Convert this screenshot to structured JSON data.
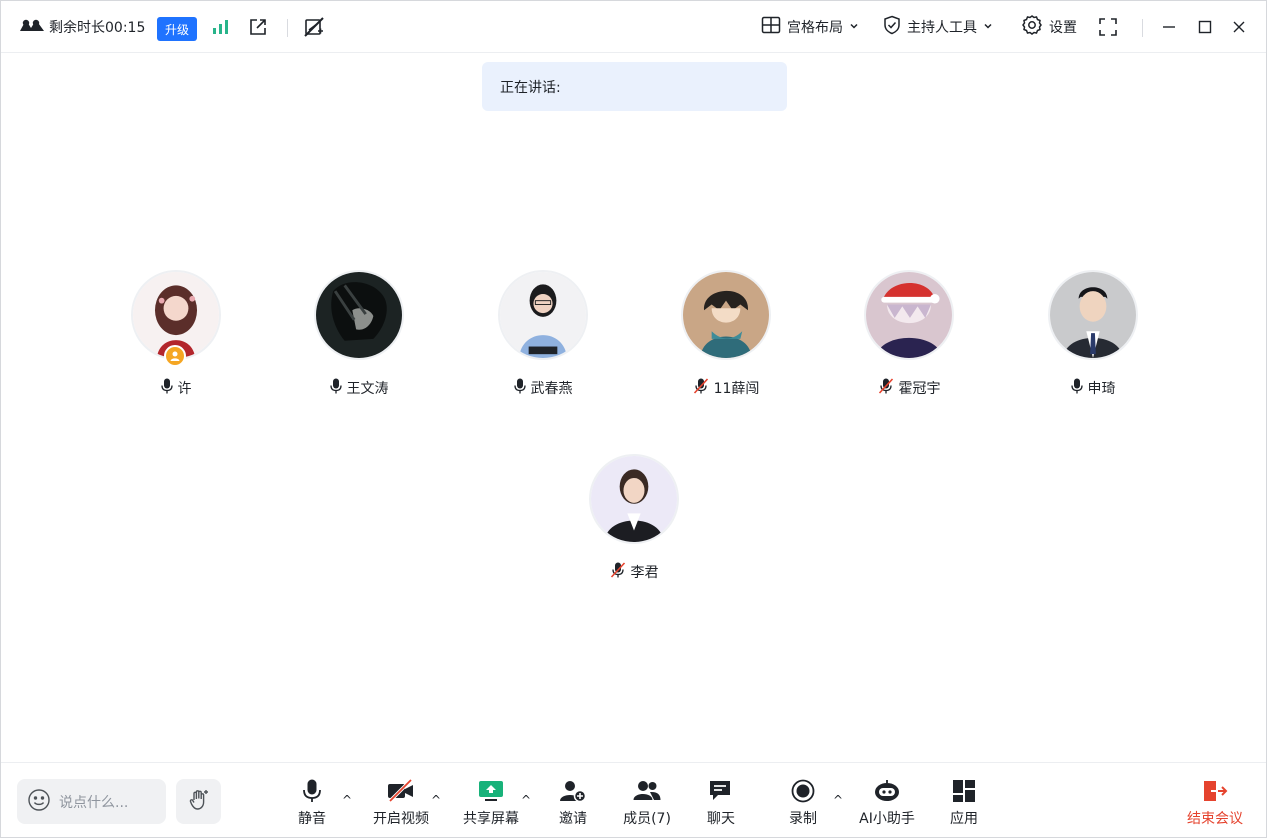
{
  "topbar": {
    "timer_text": "剩余时长00:15",
    "upgrade_label": "升级",
    "layout_label": "宫格布局",
    "host_tools_label": "主持人工具",
    "settings_label": "设置"
  },
  "speaking": {
    "label": "正在讲话:"
  },
  "participants": [
    {
      "name": "许",
      "mic": "on",
      "host": true
    },
    {
      "name": "王文涛",
      "mic": "on",
      "host": false
    },
    {
      "name": "武春燕",
      "mic": "on",
      "host": false
    },
    {
      "name": "11薛闯",
      "mic": "muted",
      "host": false
    },
    {
      "name": "霍冠宇",
      "mic": "muted",
      "host": false
    },
    {
      "name": "申琦",
      "mic": "on",
      "host": false
    },
    {
      "name": "李君",
      "mic": "muted",
      "host": false
    }
  ],
  "bottombar": {
    "chat_placeholder": "说点什么...",
    "mute_label": "静音",
    "video_label": "开启视频",
    "share_label": "共享屏幕",
    "invite_label": "邀请",
    "members_label": "成员(7)",
    "chat_label": "聊天",
    "record_label": "录制",
    "ai_label": "AI小助手",
    "apps_label": "应用",
    "end_label": "结束会议"
  },
  "colors": {
    "accent": "#1f73ff",
    "signal": "#27b48a",
    "share": "#18b27a",
    "end": "#e5432e",
    "muted_slash": "#e5432e",
    "banner": "#eaf1fd"
  }
}
